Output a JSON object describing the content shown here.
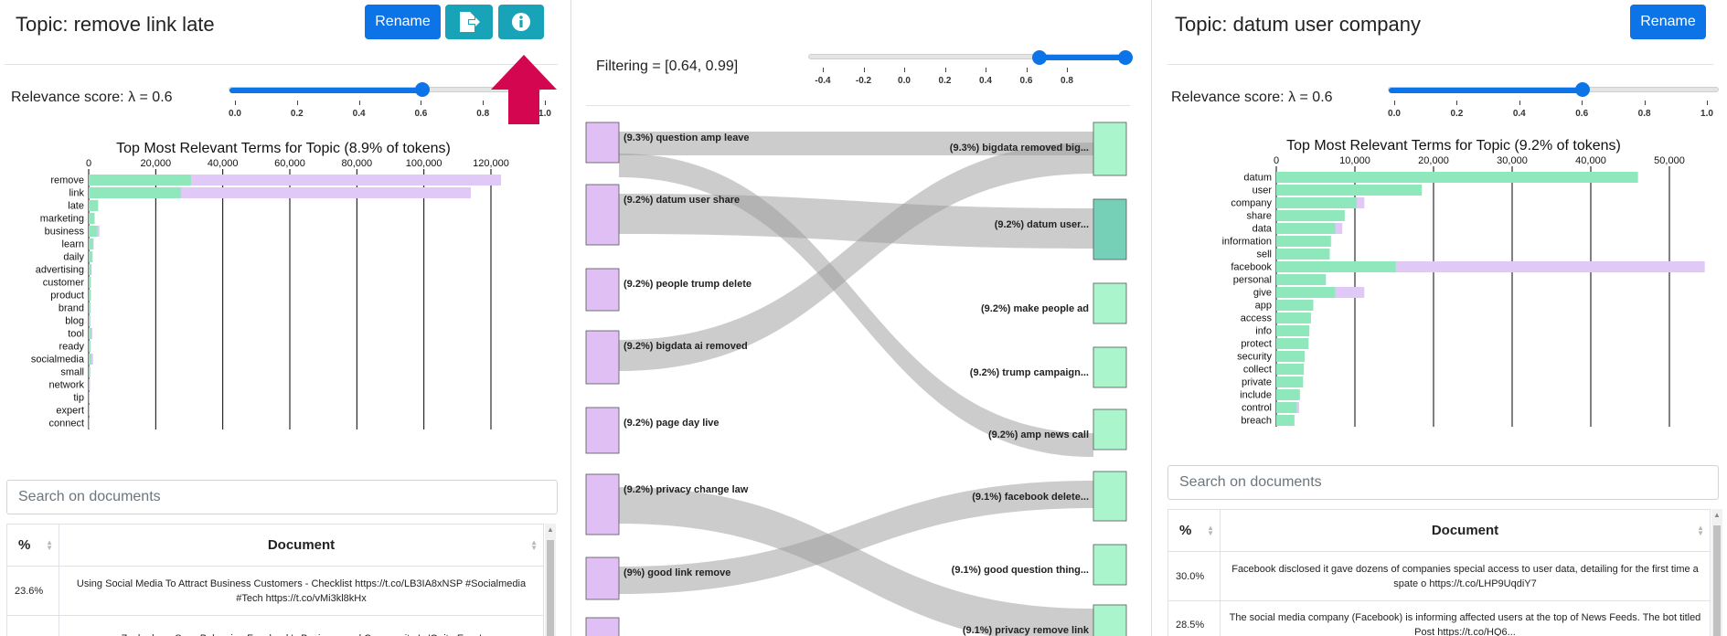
{
  "left": {
    "topic_title": "Topic: remove link late",
    "rename_label": "Rename",
    "export_icon": "file-export-icon",
    "info_icon": "info-circle-icon",
    "lambda_label": "Relevance score: λ = 0.6",
    "lambda_value": 0.6,
    "lambda_ticks": [
      "0.0",
      "0.2",
      "0.4",
      "0.6",
      "0.8",
      "1.0"
    ],
    "search_placeholder": "Search on documents",
    "table": {
      "headers": [
        "%",
        "Document"
      ],
      "rows": [
        {
          "pct": "23.6%",
          "doc": "Using Social Media To Attract Business Customers - Checklist https://t.co/LB3IA8xNSP #Socialmedia #Tech https://t.co/vMi3kl8kHx"
        },
        {
          "pct": "",
          "doc": "Zuckerberg Says Balancing Facebook's Business and Community Is 'Quite Easy'"
        }
      ]
    }
  },
  "arrow_color": "#d4064f",
  "middle": {
    "filter_label": "Filtering = [0.64, 0.99]",
    "range": [
      0.64,
      0.99
    ],
    "ticks": [
      "-0.4",
      "-0.2",
      "0.0",
      "0.2",
      "0.4",
      "0.6",
      "0.8"
    ],
    "left_nodes": [
      "(9.3%) question amp leave",
      "(9.2%) datum user share",
      "(9.2%) people trump delete",
      "(9.2%) bigdata ai removed",
      "(9.2%) page day live",
      "(9.2%) privacy change law",
      "(9%) good link remove"
    ],
    "right_nodes": [
      "(9.3%) bigdata removed big...",
      "(9.2%) datum user...",
      "(9.2%) make people ad",
      "(9.2%) trump campaign...",
      "(9.2%) amp news call",
      "(9.1%) facebook delete...",
      "(9.1%) good question thing...",
      "(9.1%) privacy remove link"
    ],
    "left_color": "#e0bff5",
    "right_color": "#aaf5cc",
    "selected_color": "#76d0b8",
    "flow_color": "#9a9a9a"
  },
  "right": {
    "topic_title": "Topic: datum user company",
    "rename_label": "Rename",
    "lambda_label": "Relevance score: λ = 0.6",
    "lambda_value": 0.6,
    "lambda_ticks": [
      "0.0",
      "0.2",
      "0.4",
      "0.6",
      "0.8",
      "1.0"
    ],
    "search_placeholder": "Search on documents",
    "table": {
      "headers": [
        "%",
        "Document"
      ],
      "rows": [
        {
          "pct": "30.0%",
          "doc": "Facebook disclosed it gave dozens of companies special access to user data, detailing for the first time a spate o https://t.co/LHP9UqdiY7"
        },
        {
          "pct": "28.5%",
          "doc": "The social media company (Facebook) is informing affected users at the top of News Feeds. The bot titled Post https://t.co/HQ6..."
        }
      ]
    }
  },
  "chart_data": [
    {
      "type": "bar",
      "title": "Top Most Relevant Terms for Topic (8.9% of tokens)",
      "orientation": "horizontal",
      "xlim": [
        0,
        120000
      ],
      "xticks": [
        0,
        20000,
        40000,
        60000,
        80000,
        100000,
        120000
      ],
      "xtick_labels": [
        "0",
        "20,000",
        "40,000",
        "60,000",
        "80,000",
        "100,000",
        "120,000"
      ],
      "grid": true,
      "categories": [
        "remove",
        "link",
        "late",
        "marketing",
        "business",
        "learn",
        "daily",
        "advertising",
        "customer",
        "product",
        "brand",
        "blog",
        "tool",
        "ready",
        "socialmedia",
        "small",
        "network",
        "tip",
        "expert",
        "connect"
      ],
      "series": [
        {
          "color": "#e0c8f7",
          "values": [
            123000,
            114000,
            2800,
            1800,
            3200,
            1500,
            1200,
            900,
            700,
            700,
            600,
            500,
            1100,
            600,
            1300,
            500,
            400,
            300,
            300,
            300
          ]
        },
        {
          "color": "#8fe8bb",
          "values": [
            30500,
            27500,
            2800,
            1700,
            2600,
            1300,
            1000,
            800,
            600,
            600,
            500,
            400,
            700,
            500,
            800,
            400,
            300,
            250,
            250,
            250
          ]
        }
      ]
    },
    {
      "type": "bar",
      "title": "Top Most Relevant Terms for Topic (9.2% of tokens)",
      "orientation": "horizontal",
      "xlim": [
        0,
        50000
      ],
      "xticks": [
        0,
        10000,
        20000,
        30000,
        40000,
        50000
      ],
      "xtick_labels": [
        "0",
        "10,000",
        "20,000",
        "30,000",
        "40,000",
        "50,000"
      ],
      "grid": true,
      "categories": [
        "datum",
        "user",
        "company",
        "share",
        "data",
        "information",
        "sell",
        "facebook",
        "personal",
        "give",
        "app",
        "access",
        "info",
        "protect",
        "security",
        "collect",
        "private",
        "include",
        "control",
        "breach"
      ],
      "series": [
        {
          "color": "#e0c8f7",
          "values": [
            46000,
            18500,
            11200,
            8700,
            8400,
            7000,
            6800,
            54500,
            6300,
            11200,
            4700,
            4400,
            4200,
            4100,
            3600,
            3500,
            3400,
            3000,
            2900,
            2300
          ]
        },
        {
          "color": "#8fe8bb",
          "values": [
            46000,
            18500,
            10200,
            8700,
            7500,
            6900,
            6800,
            15200,
            6300,
            7500,
            4700,
            4400,
            4200,
            4100,
            3600,
            3500,
            3400,
            3000,
            2600,
            2300
          ]
        }
      ]
    }
  ]
}
